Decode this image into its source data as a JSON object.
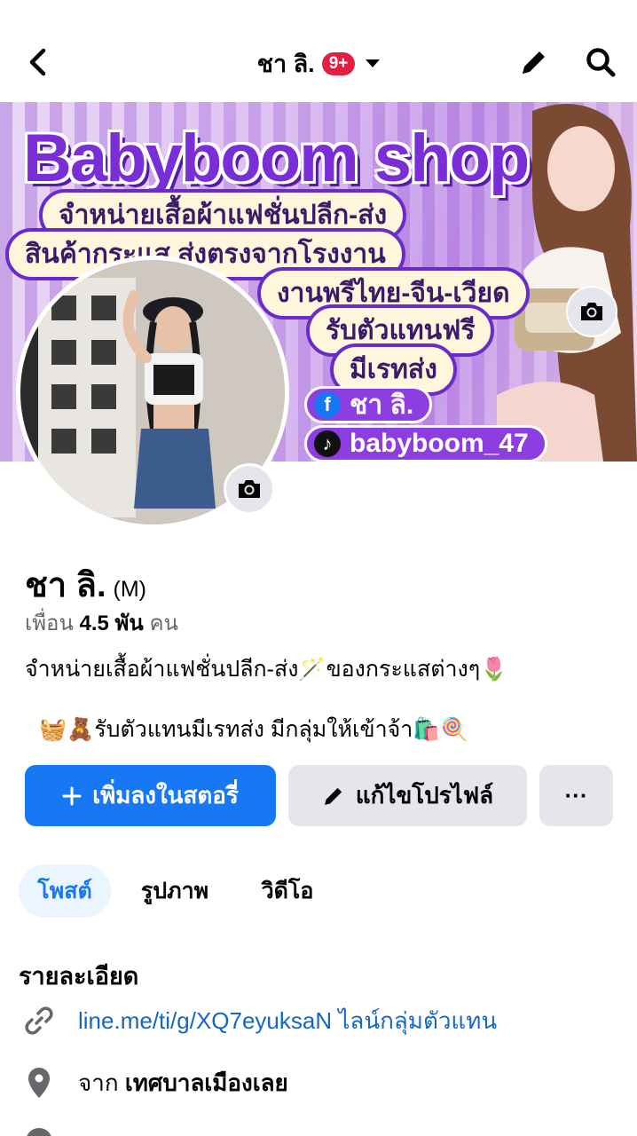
{
  "header": {
    "title": "ชา ลิ.",
    "notification_badge": "9+",
    "back_icon": "chevron-left-icon",
    "edit_icon": "pencil-icon",
    "search_icon": "search-icon"
  },
  "cover": {
    "title": "Babyboom shop",
    "lines": [
      "จำหน่ายเสื้อผ้าแฟชั่นปลีก-ส่ง",
      "สินค้ากระแส ส่งตรงจากโรงงาน",
      "งานพรีไทย-จีน-เวียด",
      "รับตัวแทนฟรี",
      "มีเรทส่ง"
    ],
    "facebook_name": "ชา ลิ.",
    "tiktok_handle": "babyboom_47"
  },
  "profile": {
    "name": "ชา ลิ.",
    "nickname": "(M)",
    "friends_label": "เพื่อน",
    "friends_count": "4.5 พัน",
    "friends_unit": "คน",
    "bio_line1": "จำหน่ายเสื้อผ้าแฟชั่นปลีก-ส่ง🪄ของกระแสต่างๆ🌷",
    "bio_line2": "🧺🧸รับตัวแทนมีเรทส่ง มีกลุ่มให้เข้าจ้า🛍️🍭"
  },
  "actions": {
    "add_story": "เพิ่มลงในสตอรี่",
    "edit_profile": "แก้ไขโปรไฟล์",
    "more": "···"
  },
  "tabs": [
    {
      "label": "โพสต์",
      "active": true
    },
    {
      "label": "รูปภาพ",
      "active": false
    },
    {
      "label": "วิดีโอ",
      "active": false
    }
  ],
  "details": {
    "title": "รายละเอียด",
    "link": "line.me/ti/g/XQ7eyuksaN ไลน์กลุ่มตัวแทน",
    "from_label": "จาก",
    "from_place": "เทศบาลเมืองเลย"
  },
  "colors": {
    "primary": "#1877f2",
    "badge": "#e41e3f",
    "secondary_bg": "#e4e6eb",
    "link": "#1766c2"
  }
}
